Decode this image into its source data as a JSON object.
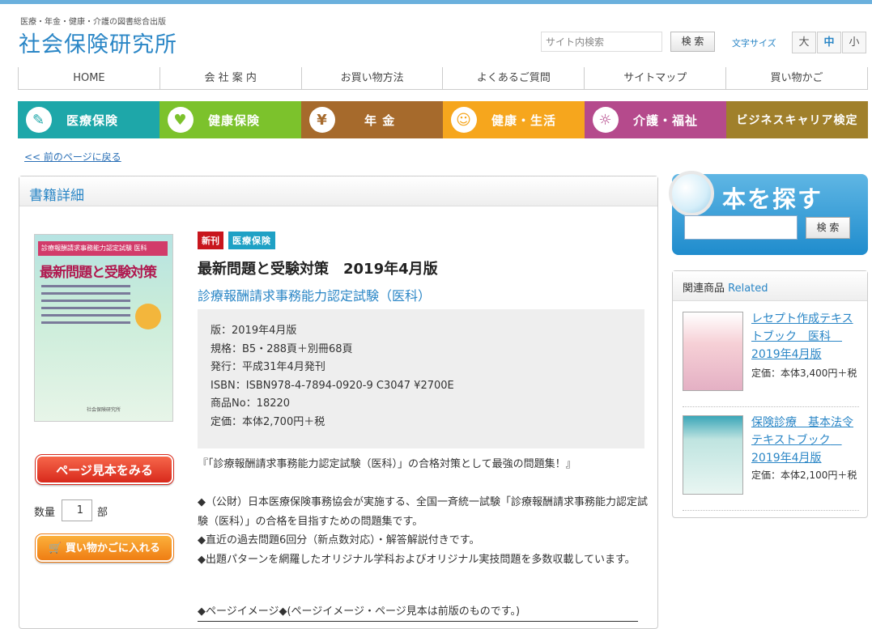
{
  "header": {
    "tagline": "医療・年金・健康・介護の図書総合出版",
    "logo": "社会保険研究所",
    "search_placeholder": "サイト内検索",
    "search_button": "検 索",
    "font_size_label": "文字サイズ",
    "font_sizes": [
      "大",
      "中",
      "小"
    ]
  },
  "global_nav": [
    "HOME",
    "会 社 案 内",
    "お買い物方法",
    "よくあるご質問",
    "サイトマップ",
    "買い物かご"
  ],
  "category_nav": [
    {
      "label": "医療保険",
      "color": "#1ea7a9",
      "icon": "syringe-icon",
      "glyph": "✎"
    },
    {
      "label": "健康保険",
      "color": "#7cc22c",
      "icon": "heart-icon",
      "glyph": "♥"
    },
    {
      "label": "年 金",
      "color": "#a66a2c",
      "icon": "yen-icon",
      "glyph": "¥"
    },
    {
      "label": "健康・生活",
      "color": "#f6a61d",
      "icon": "smile-icon",
      "glyph": "☺"
    },
    {
      "label": "介護・福祉",
      "color": "#b54a8c",
      "icon": "care-icon",
      "glyph": "☼"
    },
    {
      "label": "ビジネスキャリア検定",
      "color": "#a0802b",
      "icon": "",
      "glyph": ""
    }
  ],
  "back_link": "<< 前のページに戻る",
  "panel_title": "書籍詳細",
  "book": {
    "tag_new": "新刊",
    "tag_category": "医療保険",
    "title": "最新問題と受験対策　2019年4月版",
    "subtitle": "診療報酬請求事務能力認定試験（医科）",
    "specs": [
      "版：2019年4月版",
      "規格：B5・288頁＋別冊68頁",
      "発行：平成31年4月発刊",
      "ISBN：ISBN978-4-7894-0920-9 C3047 ¥2700E",
      "商品No：18220",
      "定価：本体2,700円＋税"
    ],
    "cover": {
      "bar": "診療報酬請求事務能力認定試験 医科",
      "title": "最新問題と受験対策",
      "publisher": "社会保険研究所"
    },
    "preview_button": "ページ見本をみる",
    "qty_label": "数量",
    "qty_value": "1",
    "qty_unit": "部",
    "cart_button": "買い物かごに入れる",
    "description": [
      "『「診療報酬請求事務能力認定試験（医科）」の合格対策として最強の問題集！』",
      "",
      "◆（公財）日本医療保険事務協会が実施する、全国一斉統一試験「診療報酬請求事務能力認定試験（医科）」の合格を目指すための問題集です。",
      "◆直近の過去問題6回分（新点数対応）・解答解説付きです。",
      "◆出題パターンを網羅したオリジナル学科およびオリジナル実技問題を多数収載しています。"
    ],
    "page_image_note": "◆ページイメージ◆(ページイメージ・ページ見本は前版のものです。)"
  },
  "find_box": {
    "title": "本を探す",
    "button": "検 索"
  },
  "related": {
    "title": "関連商品",
    "title_en": "Related",
    "items": [
      {
        "title": "レセプト作成テキストブック　医科　2019年4月版",
        "price": "定価：本体3,400円＋税"
      },
      {
        "title": "保険診療　基本法令テキストブック　2019年4月版",
        "price": "定価：本体2,100円＋税"
      }
    ]
  }
}
